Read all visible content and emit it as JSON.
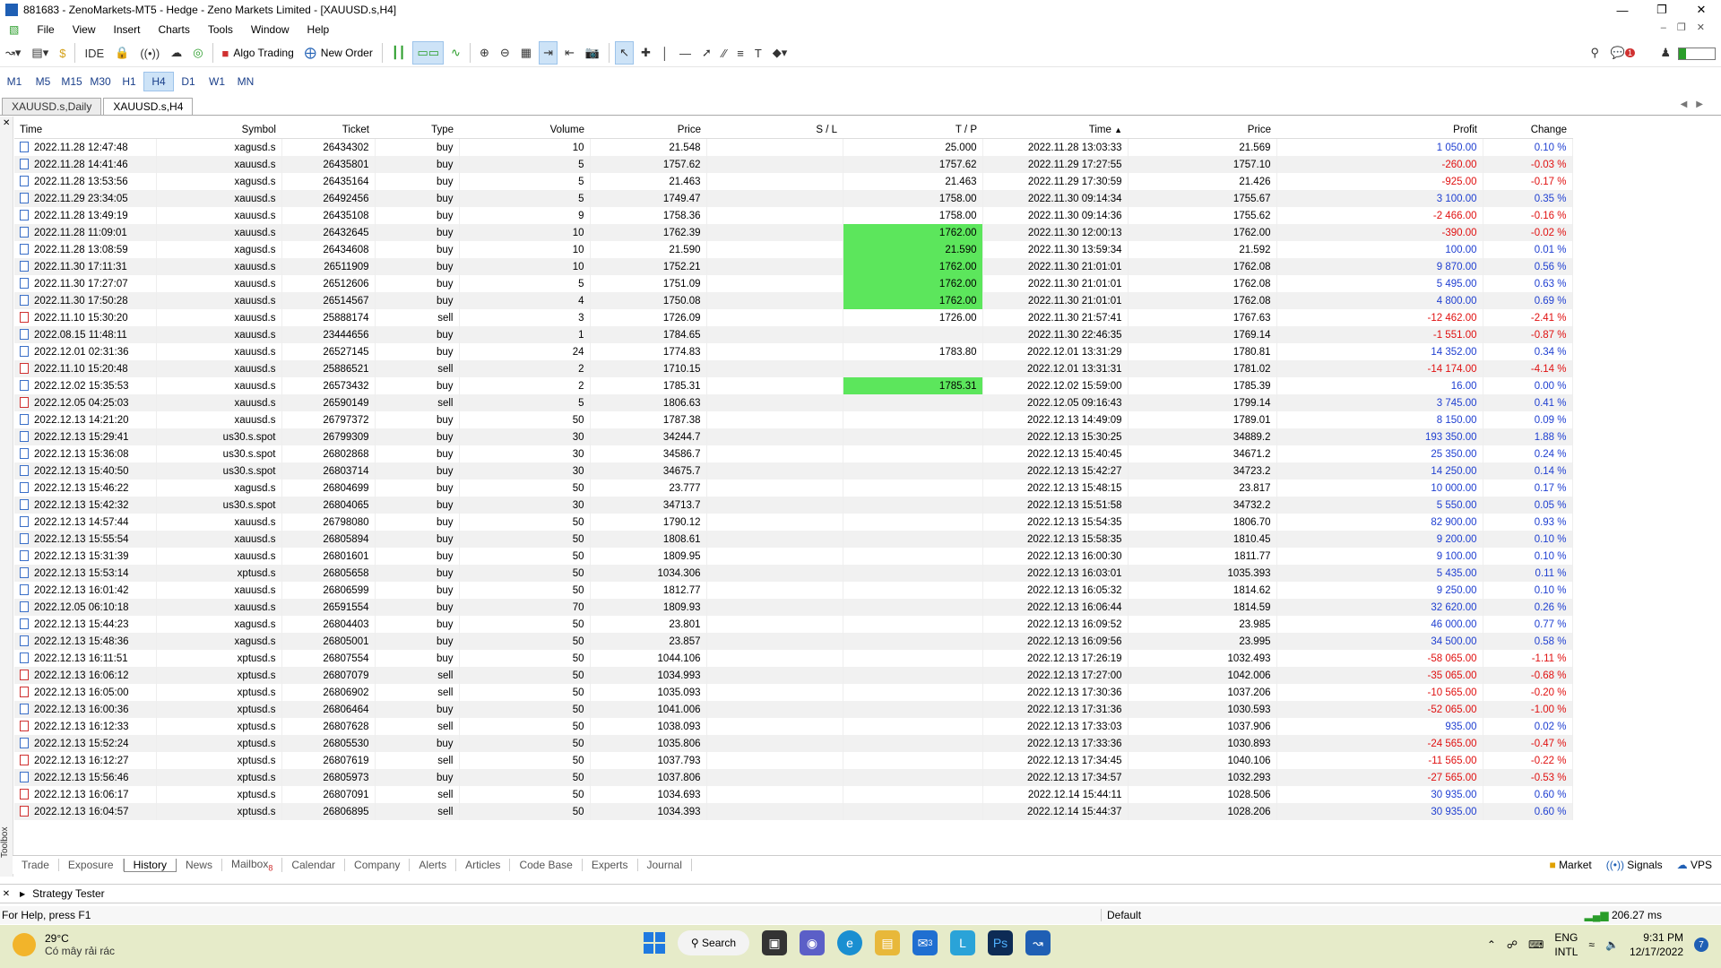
{
  "window": {
    "title": "881683 - ZenoMarkets-MT5 - Hedge - Zeno Markets Limited - [XAUUSD.s,H4]"
  },
  "menu": [
    "File",
    "View",
    "Insert",
    "Charts",
    "Tools",
    "Window",
    "Help"
  ],
  "toolbar": {
    "ide": "IDE",
    "algo_trading": "Algo Trading",
    "new_order": "New Order",
    "notif_count": "1"
  },
  "timeframes": [
    "M1",
    "M5",
    "M15",
    "M30",
    "H1",
    "H4",
    "D1",
    "W1",
    "MN"
  ],
  "chart_tabs": [
    "XAUUSD.s,Daily",
    "XAUUSD.s,H4"
  ],
  "columns": [
    "Time",
    "Symbol",
    "Ticket",
    "Type",
    "Volume",
    "Price",
    "S / L",
    "T / P",
    "Time",
    "Price",
    "Profit",
    "Change"
  ],
  "rows": [
    {
      "t1": "2022.11.28 12:47:48",
      "sym": "xagusd.s",
      "ticket": "26434302",
      "type": "buy",
      "vol": "10",
      "p1": "21.548",
      "sl": "",
      "tp": "25.000",
      "t2": "2022.11.28 13:03:33",
      "p2": "21.569",
      "profit": "1 050.00",
      "change": "0.10 %"
    },
    {
      "t1": "2022.11.28 14:41:46",
      "sym": "xauusd.s",
      "ticket": "26435801",
      "type": "buy",
      "vol": "5",
      "p1": "1757.62",
      "sl": "",
      "tp": "1757.62",
      "t2": "2022.11.29 17:27:55",
      "p2": "1757.10",
      "profit": "-260.00",
      "change": "-0.03 %"
    },
    {
      "t1": "2022.11.28 13:53:56",
      "sym": "xagusd.s",
      "ticket": "26435164",
      "type": "buy",
      "vol": "5",
      "p1": "21.463",
      "sl": "",
      "tp": "21.463",
      "t2": "2022.11.29 17:30:59",
      "p2": "21.426",
      "profit": "-925.00",
      "change": "-0.17 %"
    },
    {
      "t1": "2022.11.29 23:34:05",
      "sym": "xauusd.s",
      "ticket": "26492456",
      "type": "buy",
      "vol": "5",
      "p1": "1749.47",
      "sl": "",
      "tp": "1758.00",
      "t2": "2022.11.30 09:14:34",
      "p2": "1755.67",
      "profit": "3 100.00",
      "change": "0.35 %"
    },
    {
      "t1": "2022.11.28 13:49:19",
      "sym": "xauusd.s",
      "ticket": "26435108",
      "type": "buy",
      "vol": "9",
      "p1": "1758.36",
      "sl": "",
      "tp": "1758.00",
      "t2": "2022.11.30 09:14:36",
      "p2": "1755.62",
      "profit": "-2 466.00",
      "change": "-0.16 %"
    },
    {
      "t1": "2022.11.28 11:09:01",
      "sym": "xauusd.s",
      "ticket": "26432645",
      "type": "buy",
      "vol": "10",
      "p1": "1762.39",
      "sl": "",
      "tp": "1762.00",
      "tpg": true,
      "t2": "2022.11.30 12:00:13",
      "p2": "1762.00",
      "profit": "-390.00",
      "change": "-0.02 %"
    },
    {
      "t1": "2022.11.28 13:08:59",
      "sym": "xagusd.s",
      "ticket": "26434608",
      "type": "buy",
      "vol": "10",
      "p1": "21.590",
      "sl": "",
      "tp": "21.590",
      "tpg": true,
      "t2": "2022.11.30 13:59:34",
      "p2": "21.592",
      "profit": "100.00",
      "change": "0.01 %"
    },
    {
      "t1": "2022.11.30 17:11:31",
      "sym": "xauusd.s",
      "ticket": "26511909",
      "type": "buy",
      "vol": "10",
      "p1": "1752.21",
      "sl": "",
      "tp": "1762.00",
      "tpg": true,
      "t2": "2022.11.30 21:01:01",
      "p2": "1762.08",
      "profit": "9 870.00",
      "change": "0.56 %"
    },
    {
      "t1": "2022.11.30 17:27:07",
      "sym": "xauusd.s",
      "ticket": "26512606",
      "type": "buy",
      "vol": "5",
      "p1": "1751.09",
      "sl": "",
      "tp": "1762.00",
      "tpg": true,
      "t2": "2022.11.30 21:01:01",
      "p2": "1762.08",
      "profit": "5 495.00",
      "change": "0.63 %"
    },
    {
      "t1": "2022.11.30 17:50:28",
      "sym": "xauusd.s",
      "ticket": "26514567",
      "type": "buy",
      "vol": "4",
      "p1": "1750.08",
      "sl": "",
      "tp": "1762.00",
      "tpg": true,
      "t2": "2022.11.30 21:01:01",
      "p2": "1762.08",
      "profit": "4 800.00",
      "change": "0.69 %"
    },
    {
      "t1": "2022.11.10 15:30:20",
      "sym": "xauusd.s",
      "ticket": "25888174",
      "type": "sell",
      "vol": "3",
      "p1": "1726.09",
      "sl": "",
      "tp": "1726.00",
      "t2": "2022.11.30 21:57:41",
      "p2": "1767.63",
      "profit": "-12 462.00",
      "change": "-2.41 %"
    },
    {
      "t1": "2022.08.15 11:48:11",
      "sym": "xauusd.s",
      "ticket": "23444656",
      "type": "buy",
      "vol": "1",
      "p1": "1784.65",
      "sl": "",
      "tp": "",
      "t2": "2022.11.30 22:46:35",
      "p2": "1769.14",
      "profit": "-1 551.00",
      "change": "-0.87 %"
    },
    {
      "t1": "2022.12.01 02:31:36",
      "sym": "xauusd.s",
      "ticket": "26527145",
      "type": "buy",
      "vol": "24",
      "p1": "1774.83",
      "sl": "",
      "tp": "1783.80",
      "t2": "2022.12.01 13:31:29",
      "p2": "1780.81",
      "profit": "14 352.00",
      "change": "0.34 %"
    },
    {
      "t1": "2022.11.10 15:20:48",
      "sym": "xauusd.s",
      "ticket": "25886521",
      "type": "sell",
      "vol": "2",
      "p1": "1710.15",
      "sl": "",
      "tp": "",
      "t2": "2022.12.01 13:31:31",
      "p2": "1781.02",
      "profit": "-14 174.00",
      "change": "-4.14 %"
    },
    {
      "t1": "2022.12.02 15:35:53",
      "sym": "xauusd.s",
      "ticket": "26573432",
      "type": "buy",
      "vol": "2",
      "p1": "1785.31",
      "sl": "",
      "tp": "1785.31",
      "tpg": true,
      "t2": "2022.12.02 15:59:00",
      "p2": "1785.39",
      "profit": "16.00",
      "change": "0.00 %"
    },
    {
      "t1": "2022.12.05 04:25:03",
      "sym": "xauusd.s",
      "ticket": "26590149",
      "type": "sell",
      "vol": "5",
      "p1": "1806.63",
      "sl": "",
      "tp": "",
      "t2": "2022.12.05 09:16:43",
      "p2": "1799.14",
      "profit": "3 745.00",
      "change": "0.41 %"
    },
    {
      "t1": "2022.12.13 14:21:20",
      "sym": "xauusd.s",
      "ticket": "26797372",
      "type": "buy",
      "vol": "50",
      "p1": "1787.38",
      "sl": "",
      "tp": "",
      "t2": "2022.12.13 14:49:09",
      "p2": "1789.01",
      "profit": "8 150.00",
      "change": "0.09 %"
    },
    {
      "t1": "2022.12.13 15:29:41",
      "sym": "us30.s.spot",
      "ticket": "26799309",
      "type": "buy",
      "vol": "30",
      "p1": "34244.7",
      "sl": "",
      "tp": "",
      "t2": "2022.12.13 15:30:25",
      "p2": "34889.2",
      "profit": "193 350.00",
      "change": "1.88 %"
    },
    {
      "t1": "2022.12.13 15:36:08",
      "sym": "us30.s.spot",
      "ticket": "26802868",
      "type": "buy",
      "vol": "30",
      "p1": "34586.7",
      "sl": "",
      "tp": "",
      "t2": "2022.12.13 15:40:45",
      "p2": "34671.2",
      "profit": "25 350.00",
      "change": "0.24 %"
    },
    {
      "t1": "2022.12.13 15:40:50",
      "sym": "us30.s.spot",
      "ticket": "26803714",
      "type": "buy",
      "vol": "30",
      "p1": "34675.7",
      "sl": "",
      "tp": "",
      "t2": "2022.12.13 15:42:27",
      "p2": "34723.2",
      "profit": "14 250.00",
      "change": "0.14 %"
    },
    {
      "t1": "2022.12.13 15:46:22",
      "sym": "xagusd.s",
      "ticket": "26804699",
      "type": "buy",
      "vol": "50",
      "p1": "23.777",
      "sl": "",
      "tp": "",
      "t2": "2022.12.13 15:48:15",
      "p2": "23.817",
      "profit": "10 000.00",
      "change": "0.17 %"
    },
    {
      "t1": "2022.12.13 15:42:32",
      "sym": "us30.s.spot",
      "ticket": "26804065",
      "type": "buy",
      "vol": "30",
      "p1": "34713.7",
      "sl": "",
      "tp": "",
      "t2": "2022.12.13 15:51:58",
      "p2": "34732.2",
      "profit": "5 550.00",
      "change": "0.05 %"
    },
    {
      "t1": "2022.12.13 14:57:44",
      "sym": "xauusd.s",
      "ticket": "26798080",
      "type": "buy",
      "vol": "50",
      "p1": "1790.12",
      "sl": "",
      "tp": "",
      "t2": "2022.12.13 15:54:35",
      "p2": "1806.70",
      "profit": "82 900.00",
      "change": "0.93 %"
    },
    {
      "t1": "2022.12.13 15:55:54",
      "sym": "xauusd.s",
      "ticket": "26805894",
      "type": "buy",
      "vol": "50",
      "p1": "1808.61",
      "sl": "",
      "tp": "",
      "t2": "2022.12.13 15:58:35",
      "p2": "1810.45",
      "profit": "9 200.00",
      "change": "0.10 %"
    },
    {
      "t1": "2022.12.13 15:31:39",
      "sym": "xauusd.s",
      "ticket": "26801601",
      "type": "buy",
      "vol": "50",
      "p1": "1809.95",
      "sl": "",
      "tp": "",
      "t2": "2022.12.13 16:00:30",
      "p2": "1811.77",
      "profit": "9 100.00",
      "change": "0.10 %"
    },
    {
      "t1": "2022.12.13 15:53:14",
      "sym": "xptusd.s",
      "ticket": "26805658",
      "type": "buy",
      "vol": "50",
      "p1": "1034.306",
      "sl": "",
      "tp": "",
      "t2": "2022.12.13 16:03:01",
      "p2": "1035.393",
      "profit": "5 435.00",
      "change": "0.11 %"
    },
    {
      "t1": "2022.12.13 16:01:42",
      "sym": "xauusd.s",
      "ticket": "26806599",
      "type": "buy",
      "vol": "50",
      "p1": "1812.77",
      "sl": "",
      "tp": "",
      "t2": "2022.12.13 16:05:32",
      "p2": "1814.62",
      "profit": "9 250.00",
      "change": "0.10 %"
    },
    {
      "t1": "2022.12.05 06:10:18",
      "sym": "xauusd.s",
      "ticket": "26591554",
      "type": "buy",
      "vol": "70",
      "p1": "1809.93",
      "sl": "",
      "tp": "",
      "t2": "2022.12.13 16:06:44",
      "p2": "1814.59",
      "profit": "32 620.00",
      "change": "0.26 %"
    },
    {
      "t1": "2022.12.13 15:44:23",
      "sym": "xagusd.s",
      "ticket": "26804403",
      "type": "buy",
      "vol": "50",
      "p1": "23.801",
      "sl": "",
      "tp": "",
      "t2": "2022.12.13 16:09:52",
      "p2": "23.985",
      "profit": "46 000.00",
      "change": "0.77 %"
    },
    {
      "t1": "2022.12.13 15:48:36",
      "sym": "xagusd.s",
      "ticket": "26805001",
      "type": "buy",
      "vol": "50",
      "p1": "23.857",
      "sl": "",
      "tp": "",
      "t2": "2022.12.13 16:09:56",
      "p2": "23.995",
      "profit": "34 500.00",
      "change": "0.58 %"
    },
    {
      "t1": "2022.12.13 16:11:51",
      "sym": "xptusd.s",
      "ticket": "26807554",
      "type": "buy",
      "vol": "50",
      "p1": "1044.106",
      "sl": "",
      "tp": "",
      "t2": "2022.12.13 17:26:19",
      "p2": "1032.493",
      "profit": "-58 065.00",
      "change": "-1.11 %"
    },
    {
      "t1": "2022.12.13 16:06:12",
      "sym": "xptusd.s",
      "ticket": "26807079",
      "type": "sell",
      "vol": "50",
      "p1": "1034.993",
      "sl": "",
      "tp": "",
      "t2": "2022.12.13 17:27:00",
      "p2": "1042.006",
      "profit": "-35 065.00",
      "change": "-0.68 %"
    },
    {
      "t1": "2022.12.13 16:05:00",
      "sym": "xptusd.s",
      "ticket": "26806902",
      "type": "sell",
      "vol": "50",
      "p1": "1035.093",
      "sl": "",
      "tp": "",
      "t2": "2022.12.13 17:30:36",
      "p2": "1037.206",
      "profit": "-10 565.00",
      "change": "-0.20 %"
    },
    {
      "t1": "2022.12.13 16:00:36",
      "sym": "xptusd.s",
      "ticket": "26806464",
      "type": "buy",
      "vol": "50",
      "p1": "1041.006",
      "sl": "",
      "tp": "",
      "t2": "2022.12.13 17:31:36",
      "p2": "1030.593",
      "profit": "-52 065.00",
      "change": "-1.00 %"
    },
    {
      "t1": "2022.12.13 16:12:33",
      "sym": "xptusd.s",
      "ticket": "26807628",
      "type": "sell",
      "vol": "50",
      "p1": "1038.093",
      "sl": "",
      "tp": "",
      "t2": "2022.12.13 17:33:03",
      "p2": "1037.906",
      "profit": "935.00",
      "change": "0.02 %"
    },
    {
      "t1": "2022.12.13 15:52:24",
      "sym": "xptusd.s",
      "ticket": "26805530",
      "type": "buy",
      "vol": "50",
      "p1": "1035.806",
      "sl": "",
      "tp": "",
      "t2": "2022.12.13 17:33:36",
      "p2": "1030.893",
      "profit": "-24 565.00",
      "change": "-0.47 %"
    },
    {
      "t1": "2022.12.13 16:12:27",
      "sym": "xptusd.s",
      "ticket": "26807619",
      "type": "sell",
      "vol": "50",
      "p1": "1037.793",
      "sl": "",
      "tp": "",
      "t2": "2022.12.13 17:34:45",
      "p2": "1040.106",
      "profit": "-11 565.00",
      "change": "-0.22 %"
    },
    {
      "t1": "2022.12.13 15:56:46",
      "sym": "xptusd.s",
      "ticket": "26805973",
      "type": "buy",
      "vol": "50",
      "p1": "1037.806",
      "sl": "",
      "tp": "",
      "t2": "2022.12.13 17:34:57",
      "p2": "1032.293",
      "profit": "-27 565.00",
      "change": "-0.53 %"
    },
    {
      "t1": "2022.12.13 16:06:17",
      "sym": "xptusd.s",
      "ticket": "26807091",
      "type": "sell",
      "vol": "50",
      "p1": "1034.693",
      "sl": "",
      "tp": "",
      "t2": "2022.12.14 15:44:11",
      "p2": "1028.506",
      "profit": "30 935.00",
      "change": "0.60 %"
    },
    {
      "t1": "2022.12.13 16:04:57",
      "sym": "xptusd.s",
      "ticket": "26806895",
      "type": "sell",
      "vol": "50",
      "p1": "1034.393",
      "sl": "",
      "tp": "",
      "t2": "2022.12.14 15:44:37",
      "p2": "1028.206",
      "profit": "30 935.00",
      "change": "0.60 %"
    }
  ],
  "bottom_tabs": [
    "Trade",
    "Exposure",
    "History",
    "News",
    "Mailbox",
    "Calendar",
    "Company",
    "Alerts",
    "Articles",
    "Code Base",
    "Experts",
    "Journal"
  ],
  "mailbox_badge": "8",
  "bottom_right": [
    "Market",
    "Signals",
    "VPS"
  ],
  "toolbox_label": "Toolbox",
  "strategy_tester": "Strategy Tester",
  "status": {
    "help": "For Help, press F1",
    "profile": "Default",
    "ping": "206.27 ms"
  },
  "taskbar": {
    "temp": "29°C",
    "weather": "Có mây rải rác",
    "search": "Search",
    "mail_badge": "3",
    "lang1": "ENG",
    "lang2": "INTL",
    "time": "9:31 PM",
    "date": "12/17/2022",
    "notif": "7"
  }
}
